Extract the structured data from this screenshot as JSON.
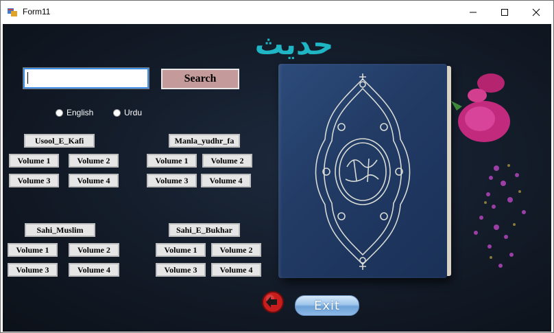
{
  "window": {
    "title": "Form11"
  },
  "heading": "حديث",
  "search": {
    "value": "",
    "button_label": "Search"
  },
  "languages": [
    {
      "label": "English",
      "selected": false
    },
    {
      "label": "Urdu",
      "selected": false
    }
  ],
  "books": [
    {
      "title": "Usool_E_Kafi",
      "volumes": [
        "Volume 1",
        "Volume 2",
        "Volume 3",
        "Volume 4"
      ]
    },
    {
      "title": "Manla_yudhr_fa",
      "volumes": [
        "Volume 1",
        "Volume 2",
        "Volume 3",
        "Volume 4"
      ]
    },
    {
      "title": "Sahi_Muslim",
      "volumes": [
        "Volume 1",
        "Volume 2",
        "Volume 3",
        "Volume 4"
      ]
    },
    {
      "title": "Sahi_E_Bukhar",
      "volumes": [
        "Volume 1",
        "Volume 2",
        "Volume 3",
        "Volume 4"
      ]
    }
  ],
  "exit_label": "Exit",
  "colors": {
    "heading": "#1fb5c4",
    "search_button": "#c49a9a",
    "background": "#141d2b"
  }
}
